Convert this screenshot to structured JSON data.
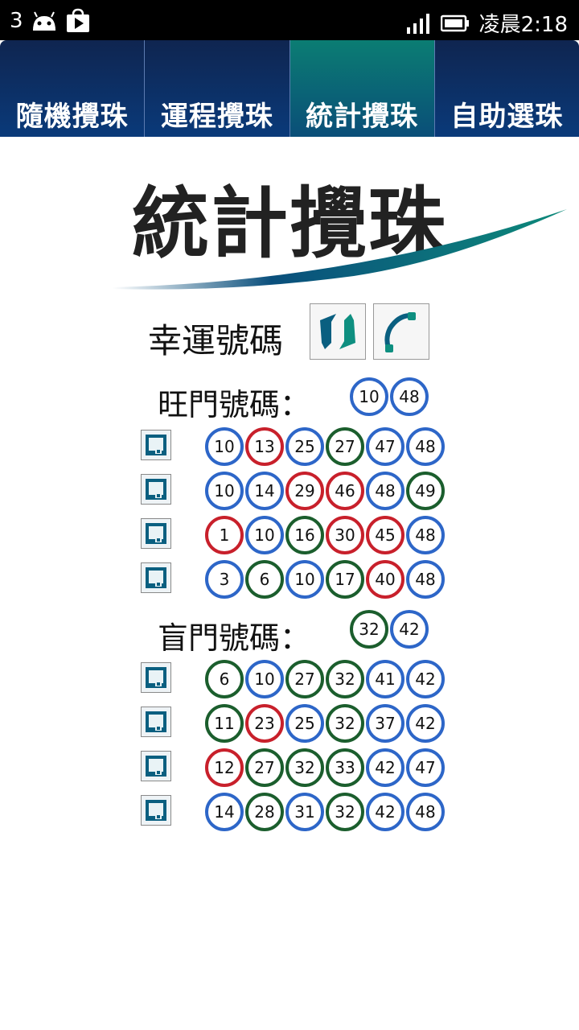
{
  "status_bar": {
    "notification_count": "3",
    "time": "凌晨2:18"
  },
  "tabs": [
    {
      "label": "隨機攪珠",
      "active": false
    },
    {
      "label": "運程攪珠",
      "active": false
    },
    {
      "label": "統計攪珠",
      "active": true
    },
    {
      "label": "自助選珠",
      "active": false
    }
  ],
  "page_title": "統計攪珠",
  "lucky_label": "幸運號碼",
  "hot": {
    "label": "旺門號碼：",
    "summary": [
      "10",
      "48"
    ],
    "rows": [
      [
        {
          "n": "10",
          "c": "blue"
        },
        {
          "n": "13",
          "c": "red"
        },
        {
          "n": "25",
          "c": "blue"
        },
        {
          "n": "27",
          "c": "green"
        },
        {
          "n": "47",
          "c": "blue"
        },
        {
          "n": "48",
          "c": "blue"
        }
      ],
      [
        {
          "n": "10",
          "c": "blue"
        },
        {
          "n": "14",
          "c": "blue"
        },
        {
          "n": "29",
          "c": "red"
        },
        {
          "n": "46",
          "c": "red"
        },
        {
          "n": "48",
          "c": "blue"
        },
        {
          "n": "49",
          "c": "green"
        }
      ],
      [
        {
          "n": "1",
          "c": "red"
        },
        {
          "n": "10",
          "c": "blue"
        },
        {
          "n": "16",
          "c": "green"
        },
        {
          "n": "30",
          "c": "red"
        },
        {
          "n": "45",
          "c": "red"
        },
        {
          "n": "48",
          "c": "blue"
        }
      ],
      [
        {
          "n": "3",
          "c": "blue"
        },
        {
          "n": "6",
          "c": "green"
        },
        {
          "n": "10",
          "c": "blue"
        },
        {
          "n": "17",
          "c": "green"
        },
        {
          "n": "40",
          "c": "red"
        },
        {
          "n": "48",
          "c": "blue"
        }
      ]
    ]
  },
  "cold": {
    "label": "盲門號碼：",
    "summary": [
      "32",
      "42"
    ],
    "rows": [
      [
        {
          "n": "6",
          "c": "green"
        },
        {
          "n": "10",
          "c": "blue"
        },
        {
          "n": "27",
          "c": "green"
        },
        {
          "n": "32",
          "c": "green"
        },
        {
          "n": "41",
          "c": "blue"
        },
        {
          "n": "42",
          "c": "blue"
        }
      ],
      [
        {
          "n": "11",
          "c": "green"
        },
        {
          "n": "23",
          "c": "red"
        },
        {
          "n": "25",
          "c": "blue"
        },
        {
          "n": "32",
          "c": "green"
        },
        {
          "n": "37",
          "c": "blue"
        },
        {
          "n": "42",
          "c": "blue"
        }
      ],
      [
        {
          "n": "12",
          "c": "red"
        },
        {
          "n": "27",
          "c": "green"
        },
        {
          "n": "32",
          "c": "green"
        },
        {
          "n": "33",
          "c": "green"
        },
        {
          "n": "42",
          "c": "blue"
        },
        {
          "n": "47",
          "c": "blue"
        }
      ],
      [
        {
          "n": "14",
          "c": "blue"
        },
        {
          "n": "28",
          "c": "green"
        },
        {
          "n": "31",
          "c": "blue"
        },
        {
          "n": "32",
          "c": "green"
        },
        {
          "n": "42",
          "c": "blue"
        },
        {
          "n": "48",
          "c": "blue"
        }
      ]
    ]
  },
  "summary_colors": {
    "hot": [
      "blue",
      "blue"
    ],
    "cold": [
      "green",
      "blue"
    ]
  },
  "icons": {
    "refresh": "refresh-icon",
    "phone": "phone-icon",
    "save": "save-icon"
  }
}
